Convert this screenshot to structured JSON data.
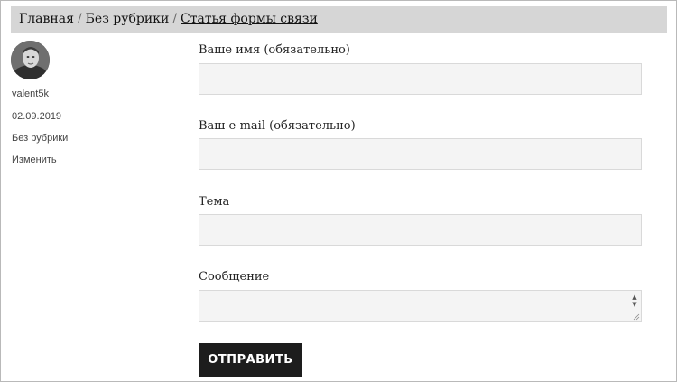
{
  "breadcrumb": {
    "home": "Главная",
    "separator": "/",
    "category": "Без рубрики",
    "current": "Статья формы связи"
  },
  "author": {
    "avatar_icon": "user-avatar-photo",
    "name": "valent5k",
    "date": "02.09.2019",
    "category": "Без рубрики",
    "edit_link": "Изменить"
  },
  "form": {
    "name_label": "Ваше имя (обязательно)",
    "name_value": "",
    "email_label": "Ваш e-mail (обязательно)",
    "email_value": "",
    "subject_label": "Тема",
    "subject_value": "",
    "message_label": "Сообщение",
    "message_value": "",
    "submit_label": "ОТПРАВИТЬ"
  },
  "colors": {
    "breadcrumb_bg": "#d6d6d6",
    "field_bg": "#f4f4f4",
    "button_bg": "#1d1d1d",
    "button_text": "#ffffff"
  }
}
